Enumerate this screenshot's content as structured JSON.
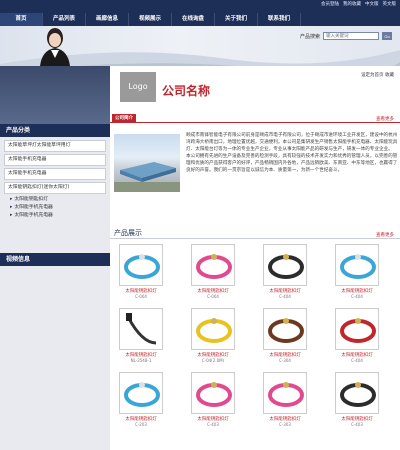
{
  "nav": {
    "items": [
      "首页",
      "产品列表",
      "画廊信息",
      "视频展示",
      "在线询盘",
      "关于我们",
      "联系我们"
    ],
    "active_index": 0
  },
  "top_links": [
    "会员登陆",
    "我的收藏",
    "中文版",
    "英文版"
  ],
  "search": {
    "label": "产品搜索",
    "placeholder": "输入关键词",
    "button": "Go"
  },
  "header": {
    "logo_text": "Logo",
    "company_name": "公司名称",
    "fav_links": "设定为首页  收藏"
  },
  "intro": {
    "title": "公司简介",
    "more": "查看更多",
    "text": "颐成市南锋智能电子有限公司前身是颐成市电子有限公司，位于颐成市进环境工业开发区，建设中的杭州湾跨海大桥南出口，地理位置优越，交通便利。本公司是集研发生产销售太阳能手机充电器、太阳能玩具灯、太阳能台灯等为一体的专业生产企业，专业从事太阳能产品的研发与生产，研发一体的专业企业。 本公司拥有先进的生产设备及完善的检测手段，具有较强的技术开发实力和优秀的管理人员，以完善的管理和优质的产品获得客户的好评，产品畅销国内外各地，产品远销欧美、东南亚、中东等地区，也赢得了良好的声誉。我们的一贯宗旨是以诚信为本、质量第一，为新一个世纪奋斗。"
  },
  "products": {
    "title": "产品展示",
    "more": "查看更多",
    "items": [
      {
        "name": "太阳能钥匙扣灯",
        "code": "C-004"
      },
      {
        "name": "太阳能钥匙扣灯",
        "code": "C-004"
      },
      {
        "name": "太阳能钥匙扣灯",
        "code": "C-404"
      },
      {
        "name": "太阳能钥匙扣灯",
        "code": "C-404"
      },
      {
        "name": "太阳能钥匙扣灯",
        "code": "NL-2548-1"
      },
      {
        "name": "太阳能钥匙扣灯",
        "code": "C-04(2.0M)"
      },
      {
        "name": "太阳能钥匙扣灯",
        "code": "C-304"
      },
      {
        "name": "太阳能钥匙扣灯",
        "code": "C-404"
      },
      {
        "name": "太阳能钥匙扣灯",
        "code": "C-203"
      },
      {
        "name": "太阳能钥匙扣灯",
        "code": "C-403"
      },
      {
        "name": "太阳能钥匙扣灯",
        "code": "C-303"
      },
      {
        "name": "太阳能钥匙扣灯",
        "code": "C-403"
      }
    ]
  },
  "sidebar": {
    "category_title": "产品分类",
    "categories": [
      "太阳能草坪灯太阳能草坪用灯",
      "太阳能手机充电器",
      "太阳能手机充电器",
      "太阳能钥匙扣灯(迷你太阳灯)"
    ],
    "subs": [
      "太阳能钥匙扣灯",
      "太阳能手机充电器",
      "太阳能手机充电器"
    ],
    "video_title": "视频信息"
  },
  "colors": {
    "nav_bg": "#1e2f57",
    "accent": "#c0262d"
  }
}
